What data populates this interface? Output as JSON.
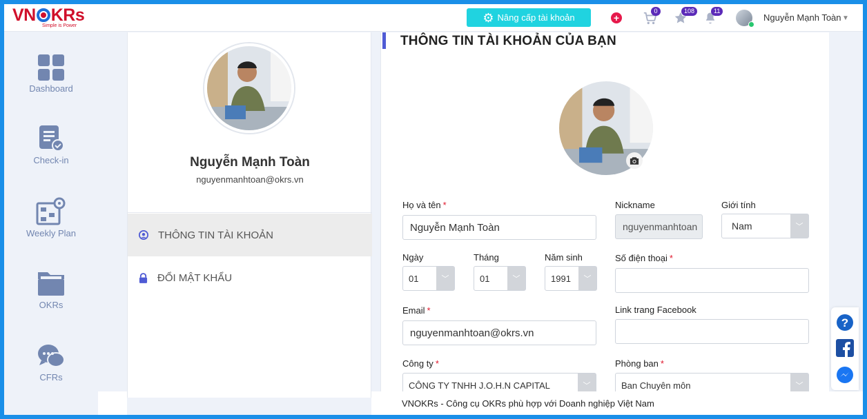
{
  "app": {
    "logo_text": "VNOKRs",
    "logo_tagline": "Simple is Power",
    "colors": {
      "accent_cyan": "#20d3e0",
      "brand_red": "#d0102b",
      "brand_blue": "#1d6fd8",
      "nav_text": "#7286b0",
      "badge": "#5b2ab8"
    }
  },
  "header": {
    "upgrade_label": "Nâng cấp tài khoản",
    "plus_icon": "plus-circle-icon",
    "cart_count": "0",
    "star_count": "108",
    "bell_count": "11",
    "user_name": "Nguyễn Mạnh Toàn"
  },
  "sidebar": {
    "items": [
      {
        "label": "Dashboard",
        "icon": "dashboard-icon"
      },
      {
        "label": "Check-in",
        "icon": "checkin-icon"
      },
      {
        "label": "Weekly Plan",
        "icon": "weekly-plan-icon"
      },
      {
        "label": "OKRs",
        "icon": "folder-icon"
      },
      {
        "label": "CFRs",
        "icon": "chat-icon"
      }
    ]
  },
  "profile": {
    "name": "Nguyễn Mạnh Toàn",
    "email": "nguyenmanhtoan@okrs.vn",
    "menu": [
      {
        "label": "THÔNG TIN TÀI KHOẢN",
        "active": true
      },
      {
        "label": "ĐỔI MẬT KHẨU",
        "active": false
      }
    ]
  },
  "form": {
    "title": "THÔNG TIN TÀI KHOẢN CỦA BẠN",
    "required_mark": "*",
    "fullname_label": "Họ và tên",
    "fullname_value": "Nguyễn Mạnh Toàn",
    "nickname_label": "Nickname",
    "nickname_value": "nguyenmanhtoan",
    "gender_label": "Giới tính",
    "gender_value": "Nam",
    "day_label": "Ngày",
    "day_value": "01",
    "month_label": "Tháng",
    "month_value": "01",
    "year_label": "Năm sinh",
    "year_value": "1991",
    "phone_label": "Số điện thoại",
    "phone_value": "",
    "email_label": "Email",
    "email_value": "nguyenmanhtoan@okrs.vn",
    "facebook_label": "Link trang Facebook",
    "facebook_value": "",
    "company_label": "Công ty",
    "company_value": "CÔNG TY TNHH J.O.H.N CAPITAL",
    "department_label": "Phòng ban",
    "department_value": "Ban Chuyên môn"
  },
  "footer": {
    "text": "VNOKRs - Công cụ OKRs phù hợp với Doanh nghiệp Việt Nam"
  }
}
